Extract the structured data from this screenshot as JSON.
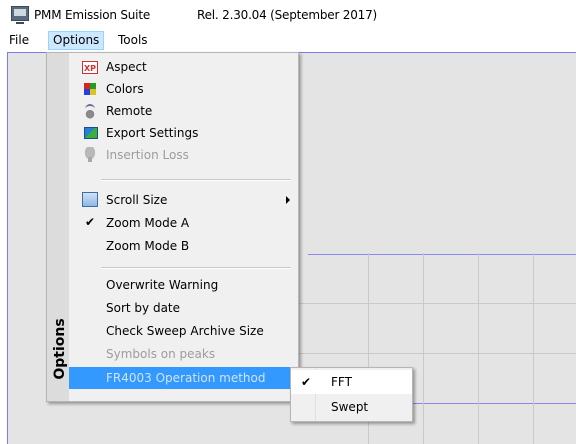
{
  "titlebar": {
    "app_name": "PMM Emission Suite",
    "release": "Rel. 2.30.04 (September 2017)",
    "icon": "monitor-icon"
  },
  "menubar": {
    "file": "File",
    "options": "Options",
    "tools": "Tools"
  },
  "options_menu": {
    "side_label": "Options",
    "items": [
      {
        "label": "Aspect",
        "icon": "aspect-icon",
        "icon_text": "XP",
        "enabled": true
      },
      {
        "label": "Colors",
        "icon": "colors-icon",
        "enabled": true
      },
      {
        "label": "Remote",
        "icon": "remote-icon",
        "enabled": true
      },
      {
        "label": "Export Settings",
        "icon": "export-settings-icon",
        "enabled": true
      },
      {
        "label": "Insertion Loss",
        "icon": "bulb-icon",
        "enabled": false
      },
      {
        "label": "Scroll Size",
        "icon": "scroll-size-icon",
        "enabled": true,
        "submenu": true
      },
      {
        "label": "Zoom Mode A",
        "checked": true,
        "enabled": true
      },
      {
        "label": "Zoom Mode B",
        "enabled": true
      },
      {
        "label": "Overwrite Warning",
        "enabled": true
      },
      {
        "label": "Sort by date",
        "enabled": true
      },
      {
        "label": "Check Sweep Archive Size",
        "enabled": true
      },
      {
        "label": "Symbols on peaks",
        "enabled": false
      },
      {
        "label": "FR4003  Operation method",
        "enabled": true,
        "highlighted": true,
        "submenu": true
      }
    ]
  },
  "operation_submenu": {
    "items": [
      {
        "label": "FFT",
        "checked": true,
        "check_mark": "✔"
      },
      {
        "label": "Swept",
        "checked": false
      }
    ]
  },
  "colors": {
    "highlight": "#3399ff",
    "menu_bg": "#f0f0f0",
    "plot_bg": "#e4e4e4",
    "grid_blue": "#7c7cf0",
    "menubar_selected": "#cce8ff"
  }
}
